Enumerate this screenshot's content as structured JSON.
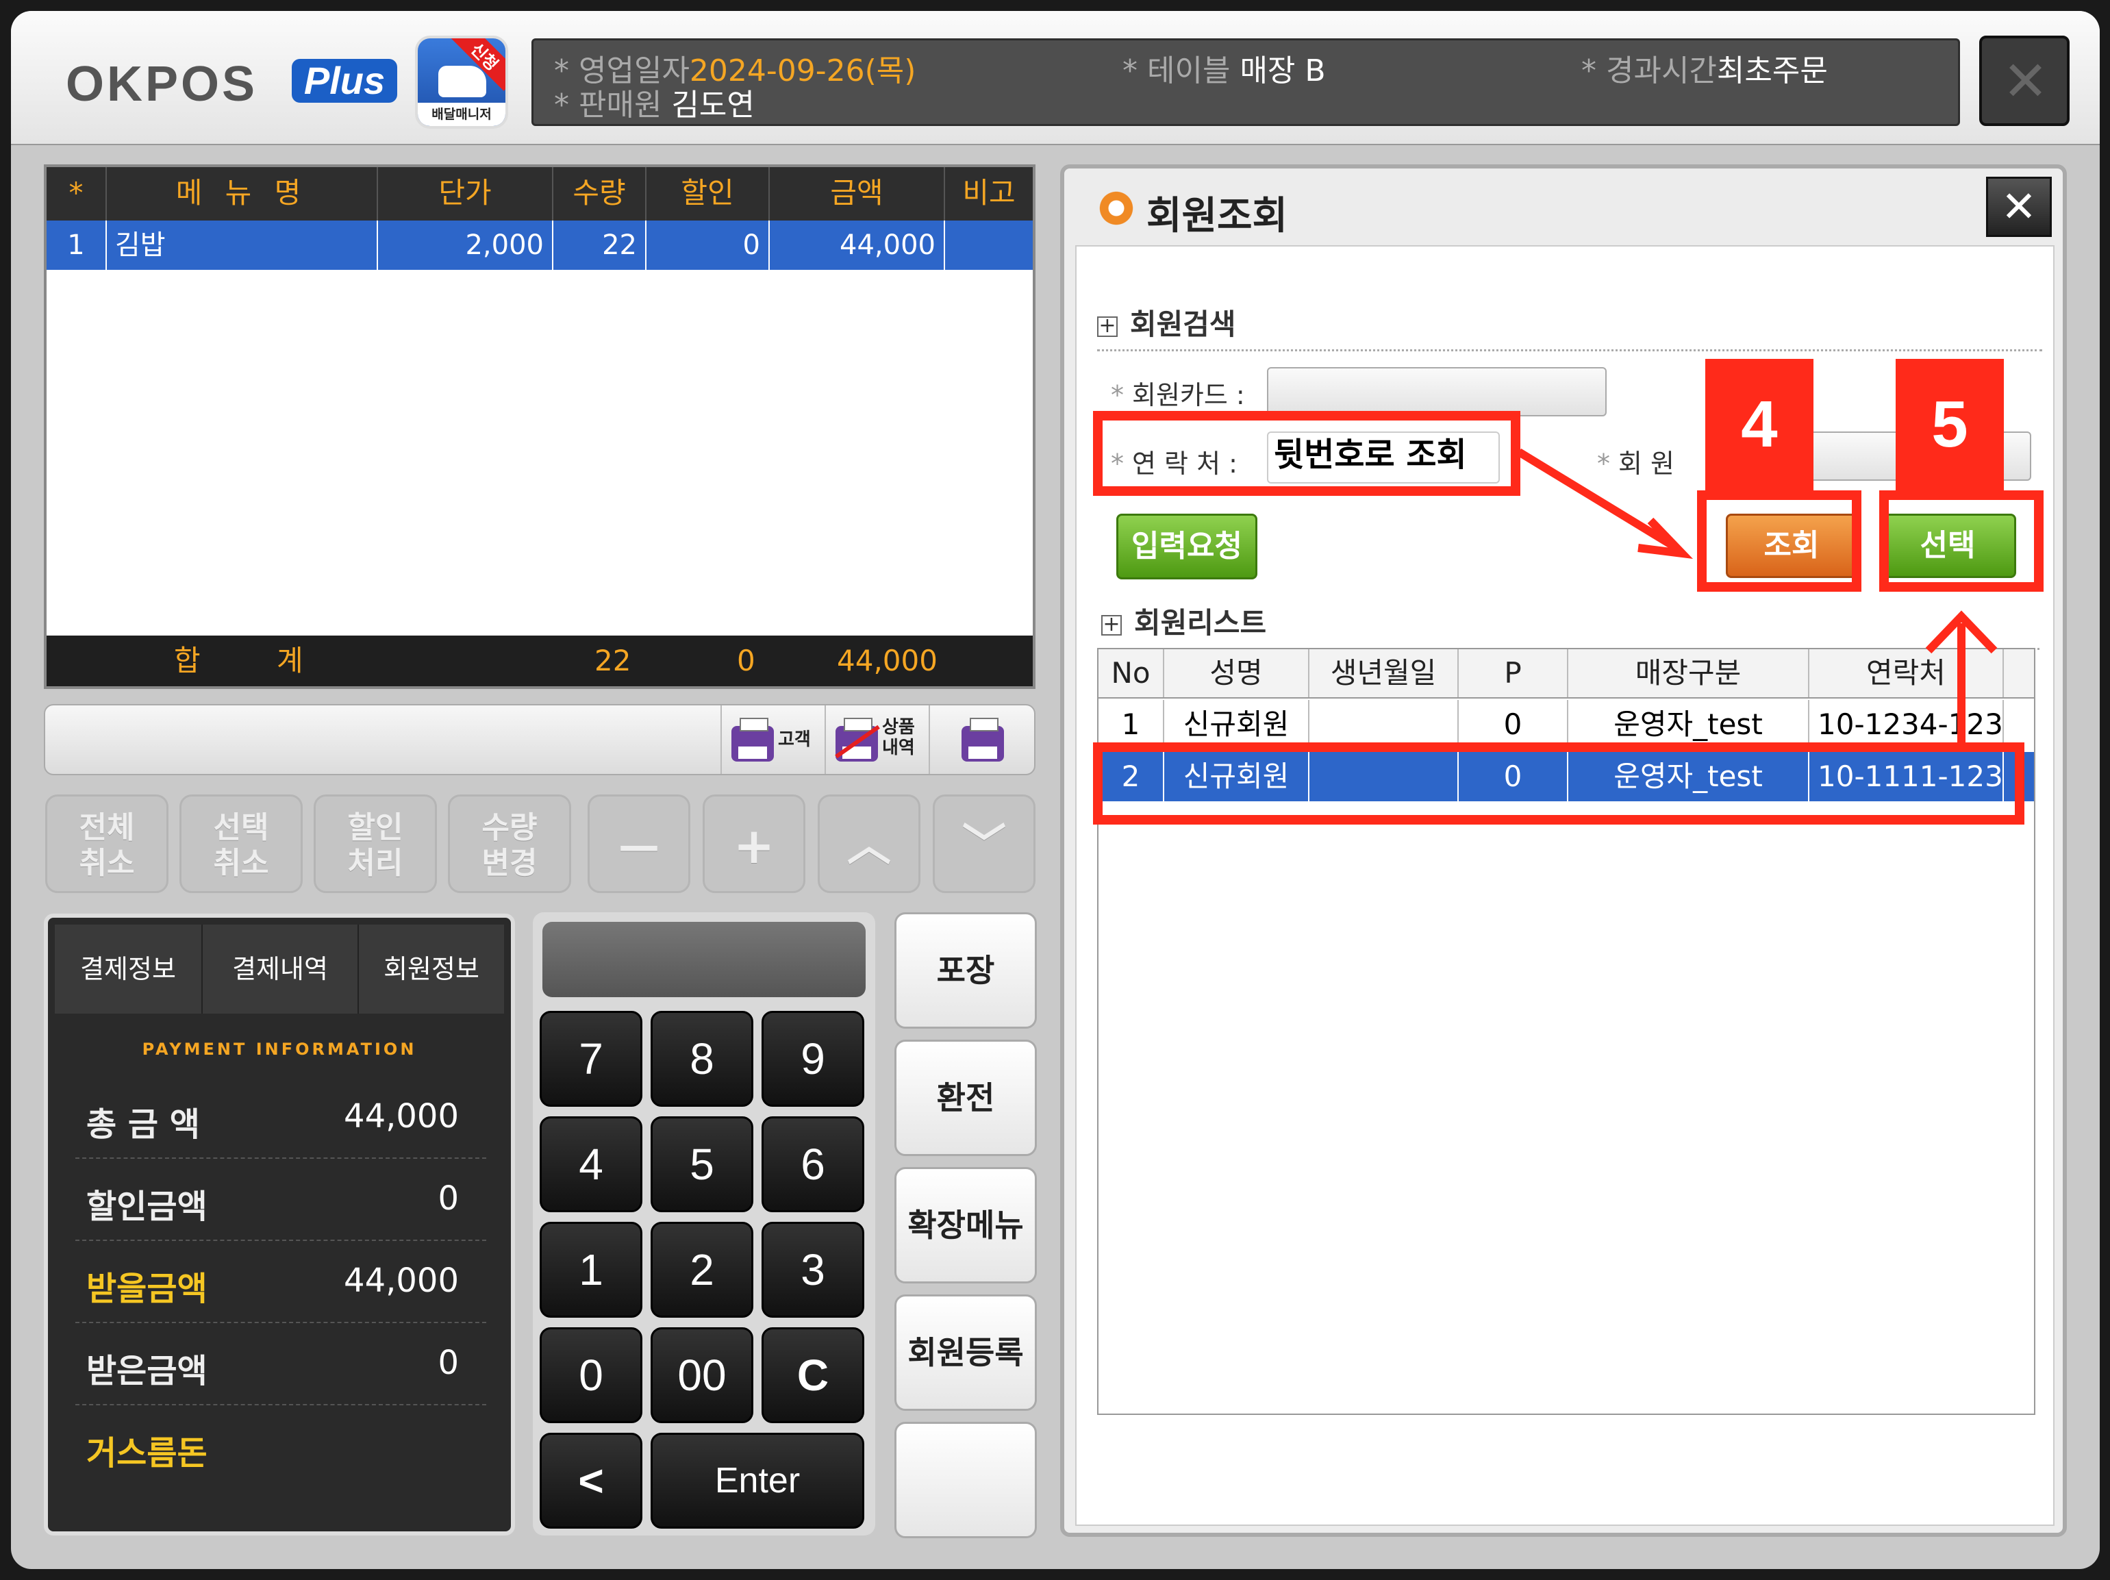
{
  "header": {
    "logo_text": "OKPOS",
    "logo_plus": "Plus",
    "delivery_badge": "신청",
    "delivery_label": "배달매니저",
    "business_date_label": "영업일자",
    "business_date_value": "2024-09-26(목)",
    "table_label": "테이블",
    "table_value": "매장 B",
    "elapsed_label": "경과시간",
    "elapsed_value": "최초주문",
    "cashier_label": "판매원",
    "cashier_value": "김도연",
    "bullet": "*"
  },
  "order_grid": {
    "columns": [
      "*",
      "메 뉴 명",
      "단가",
      "수량",
      "할인",
      "금액",
      "비고"
    ],
    "rows": [
      {
        "no": "1",
        "name": "김밥",
        "price": "2,000",
        "qty": "22",
        "discount": "0",
        "amount": "44,000",
        "note": ""
      }
    ],
    "total_label_1": "합",
    "total_label_2": "계",
    "total_qty": "22",
    "total_discount": "0",
    "total_amount": "44,000"
  },
  "print_bar": {
    "customer_label": "고객",
    "item_label_1": "상품",
    "item_label_2": "내역"
  },
  "function_buttons": [
    {
      "l1": "전체",
      "l2": "취소"
    },
    {
      "l1": "선택",
      "l2": "취소"
    },
    {
      "l1": "할인",
      "l2": "처리"
    },
    {
      "l1": "수량",
      "l2": "변경"
    },
    {
      "l1": "—",
      "l2": ""
    },
    {
      "l1": "+",
      "l2": ""
    },
    {
      "l1": "︿",
      "l2": ""
    },
    {
      "l1": "﹀",
      "l2": ""
    }
  ],
  "payment": {
    "tabs": [
      "결제정보",
      "결제내역",
      "회원정보"
    ],
    "heading": "PAYMENT INFORMATION",
    "rows": [
      {
        "label": "총 금 액",
        "value": "44,000"
      },
      {
        "label": "할인금액",
        "value": "0"
      },
      {
        "label": "받을금액",
        "value": "44,000"
      },
      {
        "label": "받은금액",
        "value": "0"
      },
      {
        "label": "거스름돈",
        "value": ""
      }
    ]
  },
  "keypad": {
    "keys": [
      "7",
      "8",
      "9",
      "4",
      "5",
      "6",
      "1",
      "2",
      "3",
      "0",
      "00",
      "C"
    ],
    "back": "<",
    "enter": "Enter"
  },
  "side_buttons": [
    "포장",
    "환전",
    "확장메뉴",
    "회원등록",
    ""
  ],
  "dialog": {
    "title": "회원조회",
    "close": "✕",
    "search_section": "회원검색",
    "card_label": "회원카드 :",
    "card_value": "",
    "phone_label": "연 락 처 :",
    "phone_value": "뒷번호로 조회",
    "name_label": "회 원",
    "name_value": "",
    "request_button": "입력요청",
    "search_button": "조회",
    "select_button": "선택",
    "list_section": "회원리스트",
    "star": "*",
    "table": {
      "columns": [
        "No",
        "성명",
        "생년월일",
        "P",
        "매장구분",
        "연락처"
      ],
      "rows": [
        {
          "no": "1",
          "name": "신규회원",
          "birth": "",
          "p": "0",
          "store": "운영자_test",
          "phone": "10-1234-123"
        },
        {
          "no": "2",
          "name": "신규회원",
          "birth": "",
          "p": "0",
          "store": "운영자_test",
          "phone": "10-1111-123"
        }
      ]
    }
  },
  "annotations": {
    "step4": "4",
    "step5": "5",
    "color": "#ff2a1a"
  },
  "colors": {
    "accent_orange": "#f5a623",
    "selection_blue": "#2d66c9",
    "green_button": "#4e9a12",
    "orange_button": "#d9641a"
  }
}
